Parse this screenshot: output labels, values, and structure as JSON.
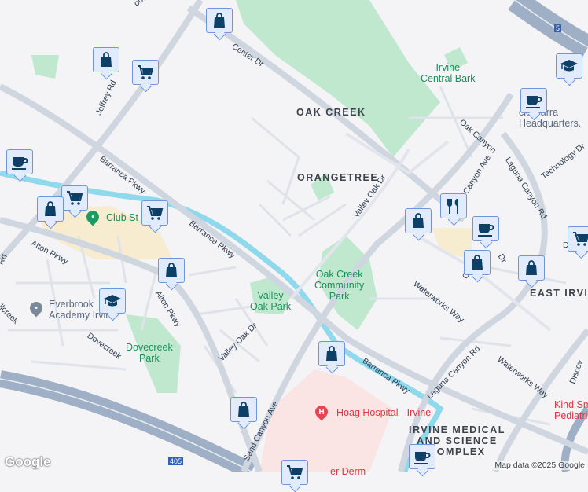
{
  "map": {
    "colors": {
      "background": "#f4f3f5",
      "road": "#cfd6df",
      "freeway": "#9fb0c6",
      "park": "#bfe8cf",
      "water": "#8fd9ec",
      "hospital": "#fbe4e4",
      "commercial": "#f7ecd0",
      "marker_fill": "#e2ebfb",
      "marker_border": "#6d96dd",
      "marker_icon": "#0e3f66"
    },
    "labels": {
      "center_dr": "Center Dr",
      "jeffrey_rd": "Jeffrey Rd",
      "barranca_pkwy_w": "Barranca Pkwy",
      "barranca_pkwy_e": "Barranca Pkwy",
      "alton_pkwy_w": "Alton Pkwy",
      "alton_pkwy_e": "Alton Pkwy",
      "valley_oak_dr_n": "Valley Oak Dr",
      "valley_oak_dr_s": "Valley Oak Dr",
      "sand_canyon_ave": "Sand Canyon Ave",
      "sand_canyon_ave_n": "Canyon Ave",
      "laguna_canyon_rd_n": "Laguna Canyon Rd",
      "laguna_canyon_rd_s": "Laguna Canyon Rd",
      "oak_canyon": "Oak Canyon",
      "technology_dr": "Technology Dr",
      "waterworks_way_n": "Waterworks Way",
      "waterworks_way_s": "Waterworks Way",
      "dovecreek": "Dovecreek",
      "rd_left": "Rd",
      "creek_left": "llcreek",
      "discovery": "Discov",
      "brook": "ook",
      "oak_creek": "OAK CREEK",
      "orangetree": "ORANGETREE",
      "east_irvine": "EAST IRVINE",
      "irvine_medical": "IRVINE MEDICAL\nAND SCIENCE\nCOMPLEX",
      "irvine_central_bark": "Irvine\nCentral Bark",
      "oak_creek_park": "Oak Creek\nCommunity\nPark",
      "valley_oak_park": "Valley\nOak Park",
      "dovecreek_park": "Dovecreek\nPark",
      "club_st": "Club St",
      "everbrook": "Everbrook\nAcademy Irvine",
      "hoag": "Hoag Hospital - Irvine",
      "kind_smiles": "Kind Sm\nPediatri",
      "barra_hq": "cie Barra\nHeadquarters.",
      "dr_right": "D",
      "dr_label": "Dr",
      "dr_left2": "O",
      "freeway_5": "5",
      "freeway_405": "405",
      "bottom_red": "er Derm"
    },
    "markers": [
      {
        "type": "shopping-bag"
      },
      {
        "type": "shopping-bag"
      },
      {
        "type": "shopping-cart"
      },
      {
        "type": "school"
      },
      {
        "type": "cafe"
      },
      {
        "type": "cafe"
      },
      {
        "type": "shopping-cart"
      },
      {
        "type": "shopping-bag"
      },
      {
        "type": "shopping-cart"
      },
      {
        "type": "shopping-bag"
      },
      {
        "type": "restaurant"
      },
      {
        "type": "cafe"
      },
      {
        "type": "shopping-bag"
      },
      {
        "type": "shopping-bag"
      },
      {
        "type": "shopping-bag"
      },
      {
        "type": "school"
      },
      {
        "type": "shopping-bag"
      },
      {
        "type": "shopping-bag"
      },
      {
        "type": "shopping-cart"
      },
      {
        "type": "cafe"
      },
      {
        "type": "shopping-cart"
      }
    ],
    "attribution": "Map data ©2025 Google",
    "logo": "Google"
  }
}
